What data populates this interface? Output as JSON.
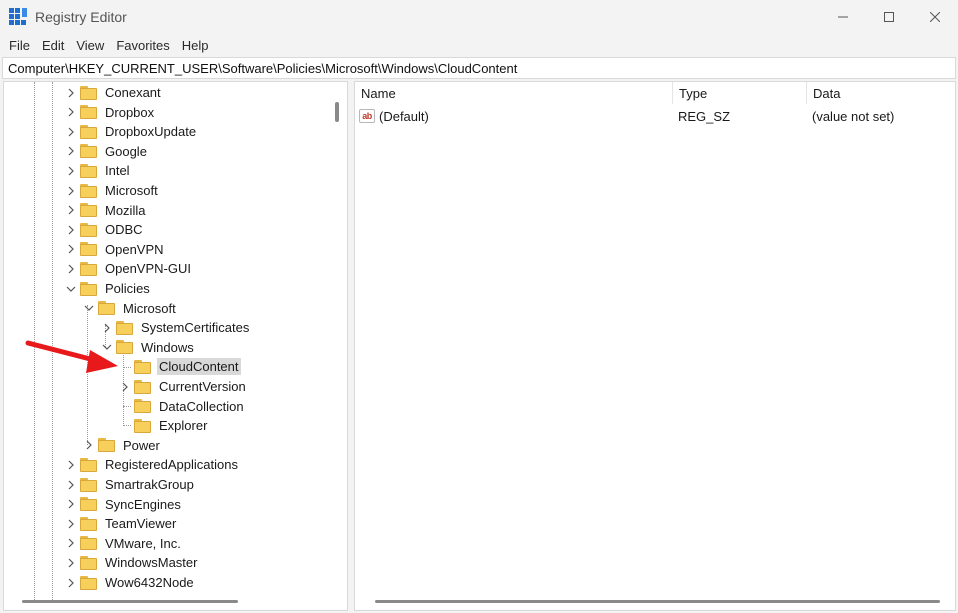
{
  "window": {
    "title": "Registry Editor",
    "controls": [
      "minimize-icon",
      "maximize-icon",
      "close-icon"
    ]
  },
  "menu": [
    {
      "label": "File"
    },
    {
      "label": "Edit"
    },
    {
      "label": "View"
    },
    {
      "label": "Favorites"
    },
    {
      "label": "Help"
    }
  ],
  "address": "Computer\\HKEY_CURRENT_USER\\Software\\Policies\\Microsoft\\Windows\\CloudContent",
  "tree": [
    {
      "label": "Conexant",
      "expander": "collapsed",
      "depth": 0
    },
    {
      "label": "Dropbox",
      "expander": "collapsed",
      "depth": 0
    },
    {
      "label": "DropboxUpdate",
      "expander": "collapsed",
      "depth": 0
    },
    {
      "label": "Google",
      "expander": "collapsed",
      "depth": 0
    },
    {
      "label": "Intel",
      "expander": "collapsed",
      "depth": 0
    },
    {
      "label": "Microsoft",
      "expander": "collapsed",
      "depth": 0
    },
    {
      "label": "Mozilla",
      "expander": "collapsed",
      "depth": 0
    },
    {
      "label": "ODBC",
      "expander": "collapsed",
      "depth": 0
    },
    {
      "label": "OpenVPN",
      "expander": "collapsed",
      "depth": 0
    },
    {
      "label": "OpenVPN-GUI",
      "expander": "collapsed",
      "depth": 0
    },
    {
      "label": "Policies",
      "expander": "expanded",
      "depth": 0
    },
    {
      "label": "Microsoft",
      "expander": "expanded",
      "depth": 1
    },
    {
      "label": "SystemCertificates",
      "expander": "collapsed",
      "depth": 2
    },
    {
      "label": "Windows",
      "expander": "expanded",
      "depth": 2
    },
    {
      "label": "CloudContent",
      "expander": "none",
      "depth": 3,
      "selected": true
    },
    {
      "label": "CurrentVersion",
      "expander": "collapsed",
      "depth": 3
    },
    {
      "label": "DataCollection",
      "expander": "none",
      "depth": 3
    },
    {
      "label": "Explorer",
      "expander": "none",
      "depth": 3
    },
    {
      "label": "Power",
      "expander": "collapsed",
      "depth": 1
    },
    {
      "label": "RegisteredApplications",
      "expander": "collapsed",
      "depth": 0
    },
    {
      "label": "SmartrakGroup",
      "expander": "collapsed",
      "depth": 0
    },
    {
      "label": "SyncEngines",
      "expander": "collapsed",
      "depth": 0
    },
    {
      "label": "TeamViewer",
      "expander": "collapsed",
      "depth": 0
    },
    {
      "label": "VMware, Inc.",
      "expander": "collapsed",
      "depth": 0
    },
    {
      "label": "WindowsMaster",
      "expander": "collapsed",
      "depth": 0
    },
    {
      "label": "Wow6432Node",
      "expander": "collapsed",
      "depth": 0
    }
  ],
  "values": {
    "columns": {
      "name": "Name",
      "type": "Type",
      "data": "Data"
    },
    "rows": [
      {
        "name": "(Default)",
        "type": "REG_SZ",
        "data": "(value not set)",
        "icon": "string-value-icon",
        "icon_text": "ab"
      }
    ]
  },
  "colors": {
    "folder": "#f7cf5b",
    "selection": "#d9d9d9",
    "annotation_arrow": "#e8191b",
    "value_icon": "#c0392b"
  }
}
